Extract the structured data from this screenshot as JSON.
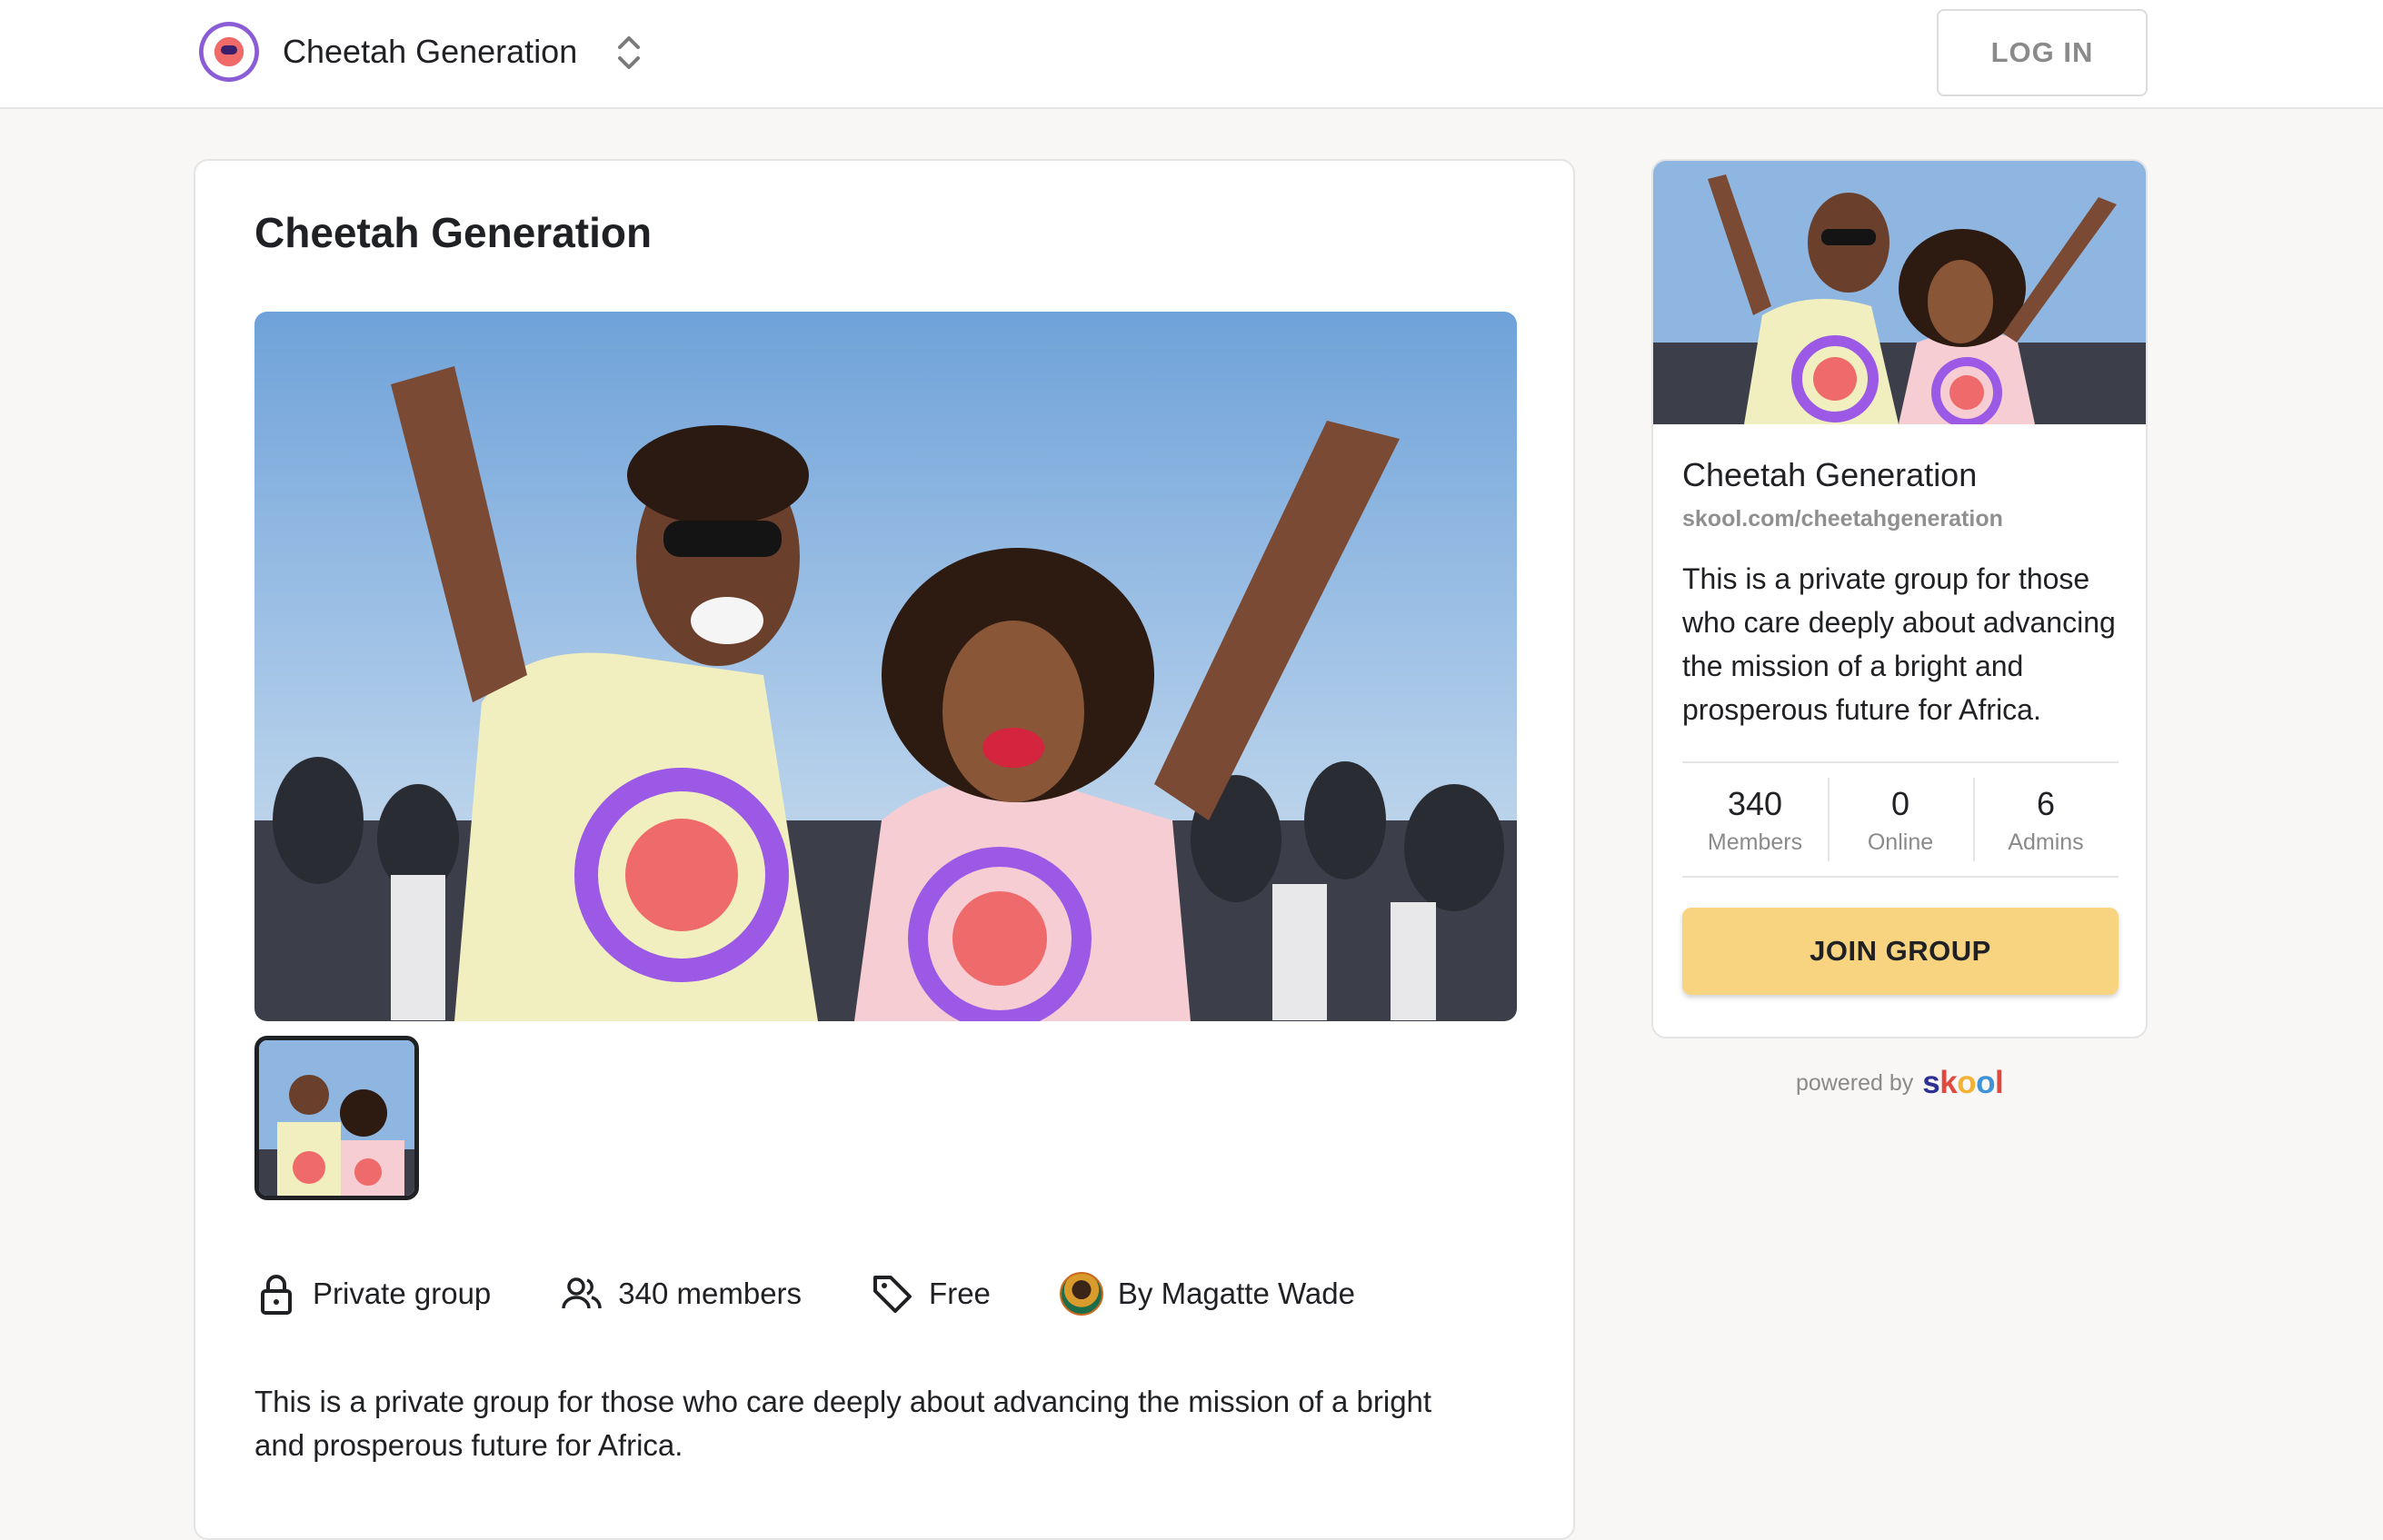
{
  "header": {
    "group_name": "Cheetah Generation",
    "login_label": "LOG IN",
    "logo_icon": "cheetah-logo-icon",
    "switcher_icon": "chevron-up-down-icon"
  },
  "main": {
    "title": "Cheetah Generation",
    "meta": {
      "privacy": "Private group",
      "members": "340 members",
      "price": "Free",
      "author": "By Magatte Wade"
    },
    "description": "This is a private group for those who care deeply about advancing the mission of a bright and prosperous future for Africa."
  },
  "side": {
    "title": "Cheetah Generation",
    "url": "skool.com/cheetahgeneration",
    "description": "This is a private group for those who care deeply about advancing the mission of a bright and prosperous future for Africa.",
    "stats": [
      {
        "value": "340",
        "label": "Members"
      },
      {
        "value": "0",
        "label": "Online"
      },
      {
        "value": "6",
        "label": "Admins"
      }
    ],
    "join_label": "JOIN GROUP"
  },
  "footer": {
    "powered_by": "powered by",
    "skool_letters": [
      "s",
      "k",
      "o",
      "o",
      "l"
    ]
  },
  "colors": {
    "accent_button": "#f8d481",
    "page_bg": "#f8f7f5",
    "border": "#e4e4e4"
  }
}
